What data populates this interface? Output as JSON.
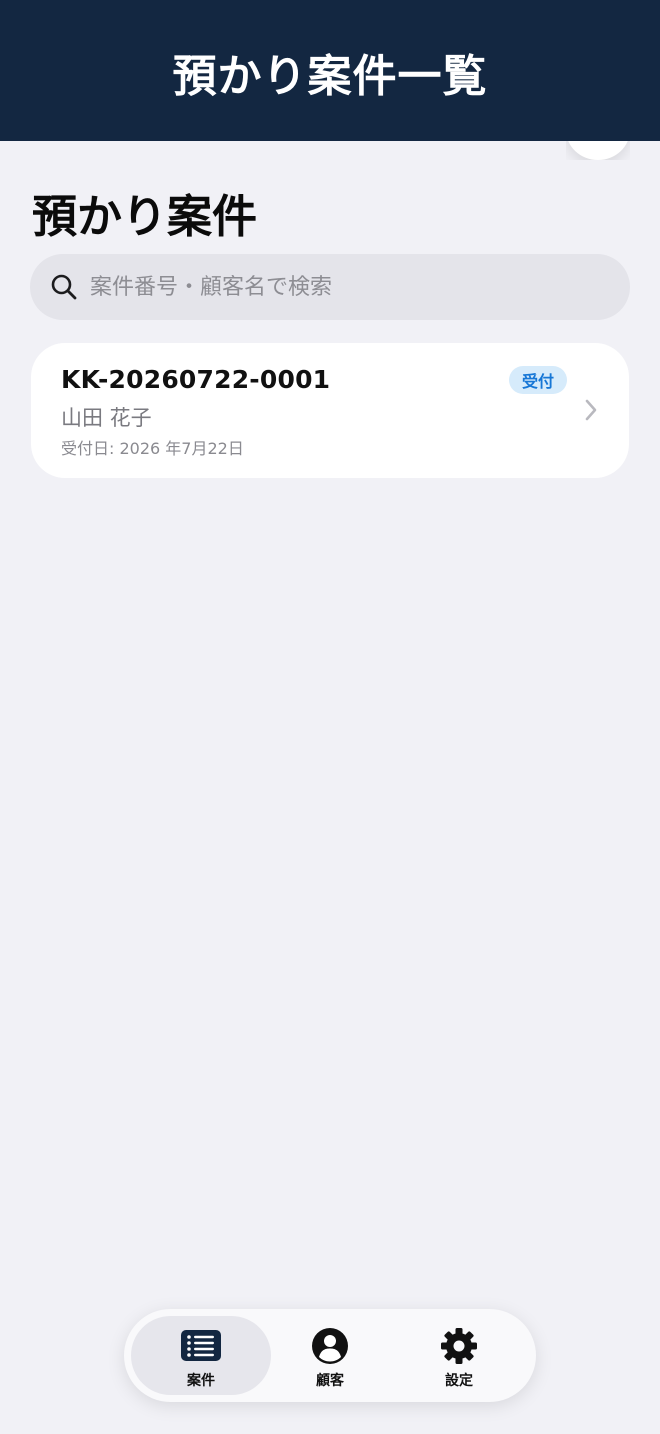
{
  "header": {
    "title": "預かり案件一覧"
  },
  "page": {
    "title": "預かり案件"
  },
  "search": {
    "placeholder": "案件番号・顧客名で検索",
    "icon": "search-icon"
  },
  "cases": [
    {
      "case_number": "KK-20260722-0001",
      "customer": "山田 花子",
      "status": "受付",
      "received": "受付日: 2026 年7月22日"
    }
  ],
  "tabs": [
    {
      "label": "案件",
      "icon": "list-icon",
      "active": true
    },
    {
      "label": "顧客",
      "icon": "person-icon",
      "active": false
    },
    {
      "label": "設定",
      "icon": "gear-icon",
      "active": false
    }
  ],
  "colors": {
    "header_bg": "#132741",
    "page_bg": "#f1f1f6",
    "badge_bg": "#d6ebfb",
    "badge_text": "#1777d6"
  }
}
